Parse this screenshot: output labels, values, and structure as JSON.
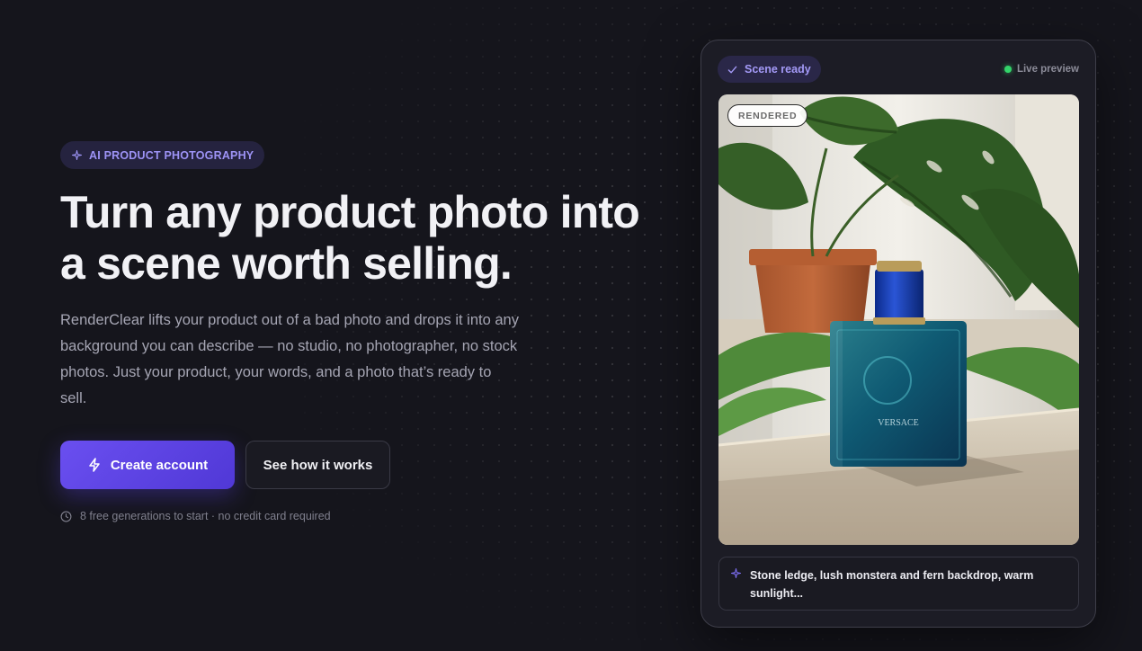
{
  "hero": {
    "badge": "AI PRODUCT PHOTOGRAPHY",
    "headline_line1": "Turn any product photo into",
    "headline_line2": "a scene worth selling.",
    "description": "RenderClear lifts your product out of a bad photo and drops it into any background you can describe — no studio, no photographer, no stock photos. Just your product, your words, and a photo that’s ready to sell.",
    "primary_cta": "Create account",
    "secondary_cta": "See how it works",
    "note": "8 free generations to start · no credit card required"
  },
  "preview": {
    "status": "Scene ready",
    "live_label": "Live preview",
    "image_badge": "RENDERED",
    "prompt": "Stone ledge, lush monstera and fern backdrop, warm sunlight..."
  },
  "colors": {
    "background": "#15151c",
    "accent": "#6a4ff0",
    "accent_text": "#9d93f5",
    "live": "#33d46a"
  },
  "icons": {
    "badge": "sparkle-icon",
    "primary_cta": "lightning-icon",
    "note": "clock-icon",
    "status": "checkmark-icon",
    "prompt": "sparkle-icon"
  }
}
